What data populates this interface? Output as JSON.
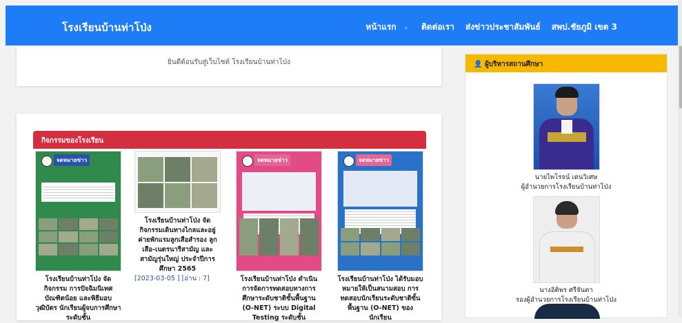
{
  "header": {
    "brand": "โรงเรียนบ้านท่าโป่ง",
    "nav": [
      {
        "label": "หน้าแรก"
      },
      {
        "label": "ติดต่อเรา"
      },
      {
        "label": "ส่งข่าวประชาสัมพันธ์"
      },
      {
        "label": "สพป.ชัยภูมิ เขต 3"
      }
    ]
  },
  "welcome": {
    "text": "ยินดีต้อนรับสู่เว็บไซต์ โรงเรียนบ้านท่าโป่ง"
  },
  "activities": {
    "title": "กิจกรรมของโรงเรียน",
    "items": [
      {
        "title": "โรงเรียนบ้านท่าโป่ง จัดกิจกรรม การปัจฉิมนิเทศบัณฑิตน้อย และพิธีมอบวุฒิบัตร นักเรียนผู้จบการศึกษาระดับชั้น",
        "badge": "จดหมายข่าว"
      },
      {
        "title": "โรงเรียนบ้านท่าโป่ง จัดกิจกรรมเดินทางไกลและอยู่ค่ายพักแรมลูกเสือสำรอง ลูกเสือ-เนตรนารีสามัญ และสามัญรุ่นใหญ่ ประจำปีการศึกษา 2565",
        "meta": "[2023-03-05 ] [อ่าน : 7]"
      },
      {
        "title": "โรงเรียนบ้านท่าโป่ง ดำเนินการจัดการทดสอบทางการศึกษาระดับชาติขั้นพื้นฐาน (O-NET) ระบบ Digital Testing ระดับชั้น",
        "badge": "จดหมายข่าว"
      },
      {
        "title": "โรงเรียนบ้านท่าโป่ง ได้รับมอบหมายให้เป็นสนามสอบ การทดสอบนักเรียนระดับชาติขั้นพื้นฐาน (O-NET) ของนักเรียน",
        "badge": "จดหมายข่าว"
      }
    ]
  },
  "admins": {
    "title": "ผู้บริหารสถานศึกษา",
    "people": [
      {
        "name": "นายไพโรจน์ เดนวิเศษ",
        "role": "ผู้อำนวยการโรงเรียนบ้านท่าโป่ง"
      },
      {
        "name": "นางอิติพร ศรีจันดา",
        "role": "รองผู้อำนวยการโรงเรียนบ้านท่าโป่ง"
      }
    ]
  },
  "icons": {
    "admin_icon": "user-icon",
    "nav_caret": "chevron-down-icon"
  }
}
